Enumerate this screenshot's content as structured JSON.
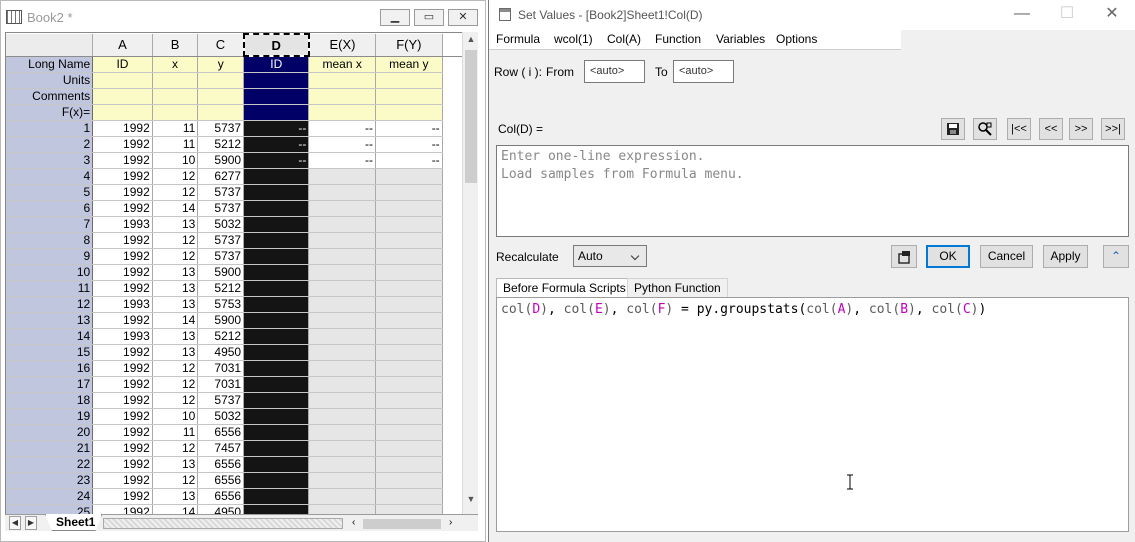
{
  "book": {
    "title": "Book2 *",
    "columns": [
      "A",
      "B",
      "C",
      "D",
      "E(X)",
      "F(Y)"
    ],
    "meta_rows": [
      {
        "label": "Long Name",
        "cells": [
          "ID",
          "x",
          "y",
          "ID",
          "mean x",
          "mean y"
        ]
      },
      {
        "label": "Units",
        "cells": [
          "",
          "",
          "",
          "",
          "",
          ""
        ]
      },
      {
        "label": "Comments",
        "cells": [
          "",
          "",
          "",
          "",
          "",
          ""
        ]
      },
      {
        "label": "F(x)=",
        "cells": [
          "",
          "",
          "",
          "",
          "",
          ""
        ]
      }
    ],
    "rows": [
      {
        "n": "1",
        "a": "1992",
        "b": "11",
        "c": "5737",
        "d": "--",
        "e": "--",
        "f": "--"
      },
      {
        "n": "2",
        "a": "1992",
        "b": "11",
        "c": "5212",
        "d": "--",
        "e": "--",
        "f": "--"
      },
      {
        "n": "3",
        "a": "1992",
        "b": "10",
        "c": "5900",
        "d": "--",
        "e": "--",
        "f": "--"
      },
      {
        "n": "4",
        "a": "1992",
        "b": "12",
        "c": "6277"
      },
      {
        "n": "5",
        "a": "1992",
        "b": "12",
        "c": "5737"
      },
      {
        "n": "6",
        "a": "1992",
        "b": "14",
        "c": "5737"
      },
      {
        "n": "7",
        "a": "1993",
        "b": "13",
        "c": "5032"
      },
      {
        "n": "8",
        "a": "1992",
        "b": "12",
        "c": "5737"
      },
      {
        "n": "9",
        "a": "1992",
        "b": "12",
        "c": "5737"
      },
      {
        "n": "10",
        "a": "1992",
        "b": "13",
        "c": "5900"
      },
      {
        "n": "11",
        "a": "1992",
        "b": "13",
        "c": "5212"
      },
      {
        "n": "12",
        "a": "1993",
        "b": "13",
        "c": "5753"
      },
      {
        "n": "13",
        "a": "1992",
        "b": "14",
        "c": "5900"
      },
      {
        "n": "14",
        "a": "1993",
        "b": "13",
        "c": "5212"
      },
      {
        "n": "15",
        "a": "1992",
        "b": "13",
        "c": "4950"
      },
      {
        "n": "16",
        "a": "1992",
        "b": "12",
        "c": "7031"
      },
      {
        "n": "17",
        "a": "1992",
        "b": "12",
        "c": "7031"
      },
      {
        "n": "18",
        "a": "1992",
        "b": "12",
        "c": "5737"
      },
      {
        "n": "19",
        "a": "1992",
        "b": "10",
        "c": "5032"
      },
      {
        "n": "20",
        "a": "1992",
        "b": "11",
        "c": "6556"
      },
      {
        "n": "21",
        "a": "1992",
        "b": "12",
        "c": "7457"
      },
      {
        "n": "22",
        "a": "1992",
        "b": "13",
        "c": "6556"
      },
      {
        "n": "23",
        "a": "1992",
        "b": "12",
        "c": "6556"
      },
      {
        "n": "24",
        "a": "1992",
        "b": "13",
        "c": "6556"
      },
      {
        "n": "25",
        "a": "1992",
        "b": "14",
        "c": "4950"
      }
    ],
    "sheet_tab": "Sheet1"
  },
  "dialog": {
    "title": "Set Values - [Book2]Sheet1!Col(D)",
    "menu": [
      "Formula",
      "wcol(1)",
      "Col(A)",
      "Function",
      "Variables",
      "Options"
    ],
    "row_label": "Row ( i ):",
    "from_label": "From",
    "from_value": "<auto>",
    "to_label": "To",
    "to_value": "<auto>",
    "col_label": "Col(D) =",
    "nav_buttons": [
      "|<<",
      "<<",
      ">>",
      ">>|"
    ],
    "expression_placeholder": "Enter one-line expression.\nLoad samples from Formula menu.",
    "recalculate_label": "Recalculate",
    "recalculate_value": "Auto",
    "ok_label": "OK",
    "cancel_label": "Cancel",
    "apply_label": "Apply",
    "tabs": [
      "Before Formula Scripts",
      "Python Function"
    ],
    "script": "col(D), col(E), col(F) = py.groupstats(col(A), col(B), col(C))"
  }
}
